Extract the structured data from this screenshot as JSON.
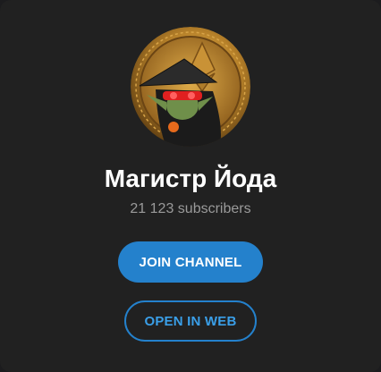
{
  "channel": {
    "title": "Магистр Йода",
    "subscribers": "21 123 subscribers",
    "avatar_icon": "yoda-bitcoin-avatar"
  },
  "actions": {
    "join_label": "JOIN CHANNEL",
    "open_web_label": "OPEN IN WEB"
  },
  "colors": {
    "background": "#212121",
    "accent": "#2481cc",
    "outline_text": "#3a9fe8",
    "subtitle": "#9a9a9a"
  }
}
